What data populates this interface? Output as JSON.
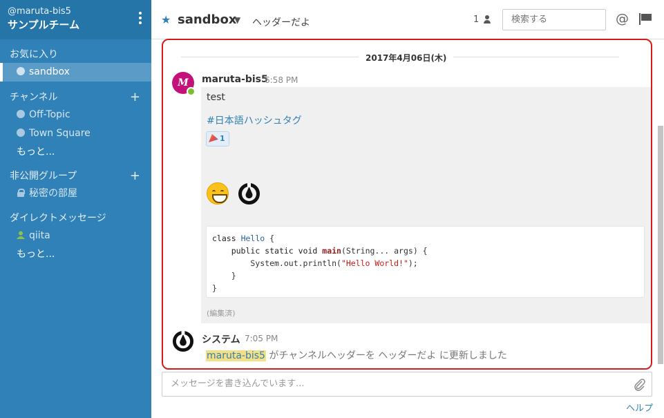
{
  "team": {
    "username": "@maruta-bis5",
    "name": "サンプルチーム"
  },
  "sidebar": {
    "favorites": {
      "title": "お気に入り",
      "items": [
        {
          "label": "sandbox",
          "icon": "globe-icon",
          "active": true
        }
      ]
    },
    "channels": {
      "title": "チャンネル",
      "add_label": "+",
      "items": [
        {
          "label": "Off-Topic",
          "icon": "globe-icon"
        },
        {
          "label": "Town Square",
          "icon": "globe-icon"
        }
      ],
      "more_label": "もっと..."
    },
    "private_groups": {
      "title": "非公開グループ",
      "add_label": "+",
      "items": [
        {
          "label": "秘密の部屋",
          "icon": "lock-icon"
        }
      ]
    },
    "direct_messages": {
      "title": "ダイレクトメッセージ",
      "items": [
        {
          "label": "qiita",
          "icon": "person-icon"
        }
      ],
      "more_label": "もっと..."
    }
  },
  "header": {
    "channel_name": "sandbox",
    "purpose": "ヘッダーだよ",
    "member_count": "1",
    "search_placeholder": "検索する",
    "mention_symbol": "@"
  },
  "posts": {
    "date_separator": "2017年4月06日(木)",
    "post1": {
      "user": "maruta-bis5",
      "avatar_letter": "M",
      "time": "6:58 PM",
      "text": "test",
      "hashtag": "#日本語ハッシュタグ",
      "reaction_count": "1",
      "code_lines": [
        "class Hello {",
        "    public static void main(String... args) {",
        "        System.out.println(\"Hello World!\");",
        "    }",
        "}"
      ],
      "edited_label": "(編集済)"
    },
    "post2": {
      "user": "システム",
      "time": "7:05 PM",
      "mention": "maruta-bis5",
      "message": " がチャンネルヘッダーを ヘッダーだよ に更新しました"
    }
  },
  "composer": {
    "placeholder": "メッセージを書き込んでいます...",
    "help_label": "ヘルプ"
  },
  "colors": {
    "sidebar_bg": "#2f81b7",
    "accent": "#2f81b7",
    "highlight_border": "#d61a1a",
    "online": "#7ebd2f"
  }
}
